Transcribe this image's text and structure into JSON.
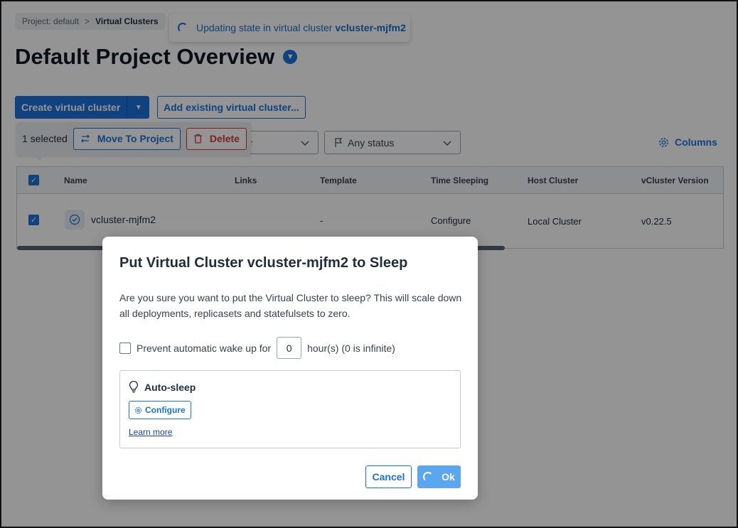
{
  "breadcrumb": {
    "project": "Project: default",
    "separator": ">",
    "current": "Virtual Clusters"
  },
  "toast": {
    "prefix": "Updating state in virtual cluster",
    "cluster": "vcluster-mjfm2"
  },
  "page": {
    "title": "Default Project Overview"
  },
  "toolbar": {
    "create_label": "Create virtual cluster",
    "add_existing_label": "Add existing virtual cluster..."
  },
  "filters": {
    "partial_text": "r",
    "status_placeholder": "Any status",
    "columns_label": "Columns"
  },
  "bulk": {
    "selected_text": "1 selected",
    "move_label": "Move To Project",
    "delete_label": "Delete"
  },
  "table": {
    "headers": {
      "name": "Name",
      "links": "Links",
      "template": "Template",
      "time_sleeping": "Time Sleeping",
      "host_cluster": "Host Cluster",
      "vcluster_version": "vCluster Version"
    },
    "row": {
      "name": "vcluster-mjfm2",
      "template": "-",
      "time_sleeping": "Configure",
      "host_cluster": "Local Cluster",
      "vcluster_version": "v0.22.5"
    }
  },
  "modal": {
    "title": "Put Virtual Cluster vcluster-mjfm2 to Sleep",
    "description": "Are you sure you want to put the Virtual Cluster to sleep? This will scale down all deployments, replicasets and statefulsets to zero.",
    "prevent_label": "Prevent automatic wake up for",
    "hours_value": "0",
    "hours_suffix": "hour(s) (0 is infinite)",
    "autosleep_title": "Auto-sleep",
    "configure_label": "Configure",
    "learn_more": "Learn more",
    "cancel_label": "Cancel",
    "ok_label": "Ok"
  },
  "colors": {
    "primary": "#1a73d9",
    "danger": "#d33b3b",
    "ok_disabled": "#5aa6f0"
  }
}
